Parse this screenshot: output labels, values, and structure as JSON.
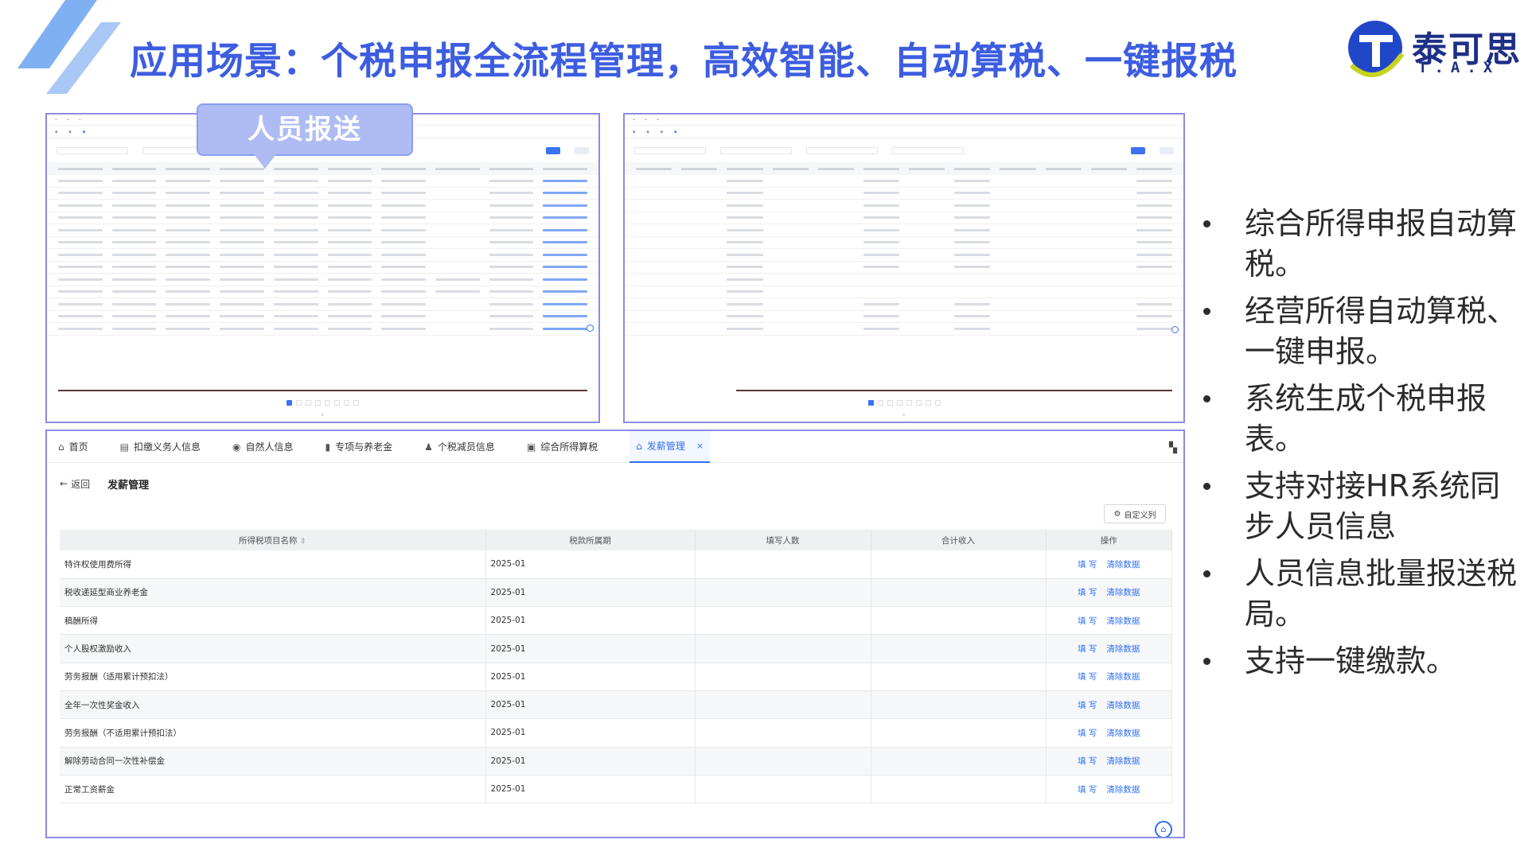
{
  "title": "应用场景：个税申报全流程管理，高效智能、自动算税、一键报税",
  "logo": {
    "name": "泰可思",
    "sub": "T.A.X"
  },
  "bubble": "人员报送",
  "nav": {
    "items": [
      {
        "label": "首页",
        "icon": "home-icon"
      },
      {
        "label": "扣缴义务人信息",
        "icon": "document-icon"
      },
      {
        "label": "自然人信息",
        "icon": "user-circle-icon"
      },
      {
        "label": "专项与养老金",
        "icon": "book-icon"
      },
      {
        "label": "个税减员信息",
        "icon": "user-icon"
      },
      {
        "label": "综合所得算税",
        "icon": "calculator-icon"
      },
      {
        "label": "发薪管理",
        "icon": "house-icon",
        "active": true
      }
    ]
  },
  "breadcrumb": {
    "back": "返回",
    "page": "发薪管理"
  },
  "custom_columns": "自定义列",
  "table": {
    "headers": [
      "所得税项目名称",
      "税款所属期",
      "填写人数",
      "合计收入",
      "操作"
    ],
    "rows": [
      {
        "name": "特许权使用费所得",
        "period": "2025-01"
      },
      {
        "name": "税收递延型商业养老金",
        "period": "2025-01"
      },
      {
        "name": "稿酬所得",
        "period": "2025-01"
      },
      {
        "name": "个人股权激励收入",
        "period": "2025-01"
      },
      {
        "name": "劳务报酬（适用累计预扣法）",
        "period": "2025-01"
      },
      {
        "name": "全年一次性奖金收入",
        "period": "2025-01"
      },
      {
        "name": "劳务报酬（不适用累计预扣法）",
        "period": "2025-01"
      },
      {
        "name": "解除劳动合同一次性补偿金",
        "period": "2025-01"
      },
      {
        "name": "正常工资薪金",
        "period": "2025-01"
      }
    ],
    "op_fill": "填 写",
    "op_clear": "清除数据"
  },
  "bullets": [
    "综合所得申报自动算税。",
    "经营所得自动算税、一键申报。",
    "系统生成个税申报表。",
    "支持对接HR系统同步人员信息",
    "人员信息批量报送税局。",
    "支持一键缴款。"
  ],
  "colors": {
    "title": "#3d5de0",
    "frame": "#8b8be6",
    "link": "#2f6ff0",
    "logo": "#1d2f86"
  }
}
